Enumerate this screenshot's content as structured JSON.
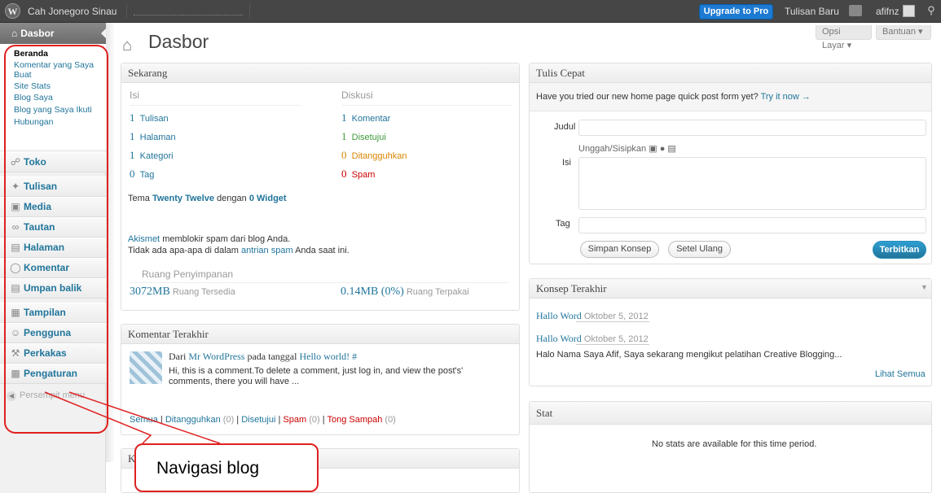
{
  "adminbar": {
    "wp_logo": "W",
    "site_name": "Cah Jonegoro Sinau",
    "upgrade": "Upgrade to Pro",
    "new_post": "Tulisan Baru",
    "user": "afifnz",
    "search_icon": "search-icon"
  },
  "sidebar": {
    "dashboard": "Dasbor",
    "submenu": [
      "Beranda",
      "Komentar yang Saya Buat",
      "Site Stats",
      "Blog Saya",
      "Blog yang Saya Ikuti",
      "Hubungan"
    ],
    "items": [
      {
        "label": "Toko",
        "icon": "cart-icon"
      },
      {
        "label": "Tulisan",
        "icon": "pin-icon"
      },
      {
        "label": "Media",
        "icon": "media-icon"
      },
      {
        "label": "Tautan",
        "icon": "link-icon"
      },
      {
        "label": "Halaman",
        "icon": "page-icon"
      },
      {
        "label": "Komentar",
        "icon": "comment-icon"
      },
      {
        "label": "Umpan balik",
        "icon": "feedback-icon"
      },
      {
        "label": "Tampilan",
        "icon": "appearance-icon"
      },
      {
        "label": "Pengguna",
        "icon": "users-icon"
      },
      {
        "label": "Perkakas",
        "icon": "tools-icon"
      },
      {
        "label": "Pengaturan",
        "icon": "settings-icon"
      }
    ],
    "collapse": "Persempit menu"
  },
  "header": {
    "title": "Dasbor",
    "screen_options": "Opsi Layar",
    "help": "Bantuan"
  },
  "right_now": {
    "title": "Sekarang",
    "col_content": "Isi",
    "col_discussion": "Diskusi",
    "content": [
      {
        "count": "1",
        "label": "Tulisan"
      },
      {
        "count": "1",
        "label": "Halaman"
      },
      {
        "count": "1",
        "label": "Kategori"
      },
      {
        "count": "0",
        "label": "Tag"
      }
    ],
    "discussion": [
      {
        "count": "1",
        "label": "Komentar"
      },
      {
        "count": "1",
        "label": "Disetujui"
      },
      {
        "count": "0",
        "label": "Ditangguhkan"
      },
      {
        "count": "0",
        "label": "Spam"
      }
    ],
    "theme_prefix": "Tema",
    "theme_name": "Twenty Twelve",
    "theme_mid": "dengan",
    "widgets": "0 Widget",
    "akismet": "Akismet",
    "akismet_text": "memblokir spam dari blog Anda.",
    "spam_line_prefix": "Tidak ada apa-apa di dalam",
    "spam_queue": "antrian spam",
    "spam_line_suffix": "Anda saat ini.",
    "storage_title": "Ruang Penyimpanan",
    "available_value": "3072MB",
    "available_label": "Ruang Tersedia",
    "used_value": "0.14MB (0%)",
    "used_label": "Ruang Terpakai"
  },
  "recent_comments": {
    "title": "Komentar Terakhir",
    "from": "Dari",
    "author": "Mr WordPress",
    "on": "pada tanggal",
    "post": "Hello world! #",
    "text": "Hi, this is a comment.To delete a comment, just log in, and view the post's' comments, there you will have ...",
    "filters": [
      {
        "label": "Semua",
        "count": ""
      },
      {
        "label": "Ditangguhkan",
        "count": "(0)"
      },
      {
        "label": "Disetujui",
        "count": ""
      },
      {
        "label": "Spam",
        "count": "(0)"
      },
      {
        "label": "Tong Sampah",
        "count": "(0)"
      }
    ]
  },
  "quick_draft": {
    "title": "Tulis Cepat",
    "notice": "Have you tried our new home page quick post form yet?",
    "notice_link": "Try it now →",
    "title_label": "Judul",
    "upload_label": "Unggah/Sisipkan",
    "content_label": "Isi",
    "tags_label": "Tag",
    "save_draft": "Simpan Konsep",
    "reset": "Setel Ulang",
    "publish": "Terbitkan"
  },
  "recent_drafts": {
    "title": "Konsep Terakhir",
    "items": [
      {
        "title": "Hallo Word",
        "date": "Oktober 5, 2012"
      },
      {
        "title": "Hallo Word",
        "date": "Oktober 5, 2012"
      }
    ],
    "excerpt": "Halo Nama Saya Afif, Saya sekarang mengikut pelatihan Creative Blogging...",
    "view_all": "Lihat Semua"
  },
  "stats": {
    "title": "Stat",
    "empty": "No stats are available for this time period."
  },
  "partial_box_title": "Kegiatan Anda",
  "annotation": {
    "label": "Navigasi blog",
    "color": "#e02020"
  }
}
